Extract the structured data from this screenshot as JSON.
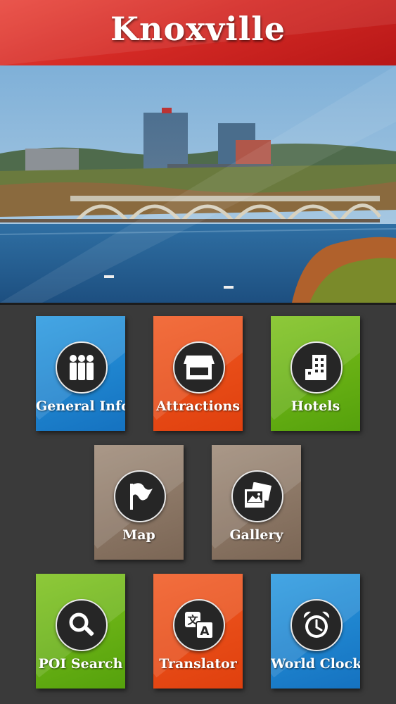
{
  "header": {
    "title": "Knoxville"
  },
  "hero": {
    "description_icon": "city-skyline-photo"
  },
  "tiles": [
    {
      "label": "General Info",
      "icon": "people-icon"
    },
    {
      "label": "Attractions",
      "icon": "storefront-icon"
    },
    {
      "label": "Hotels",
      "icon": "hotel-building-icon"
    },
    {
      "label": "Map",
      "icon": "flag-icon"
    },
    {
      "label": "Gallery",
      "icon": "photos-icon"
    },
    {
      "label": "POI Search",
      "icon": "magnifier-icon"
    },
    {
      "label": "Translator",
      "icon": "translate-icon"
    },
    {
      "label": "World Clock",
      "icon": "alarm-clock-icon"
    }
  ],
  "colors": {
    "header": "#d42a25",
    "blue": "#1c82cf",
    "orange": "#e84a16",
    "green": "#66b014",
    "brown": "#8a7462",
    "background": "#3a3a3a"
  }
}
